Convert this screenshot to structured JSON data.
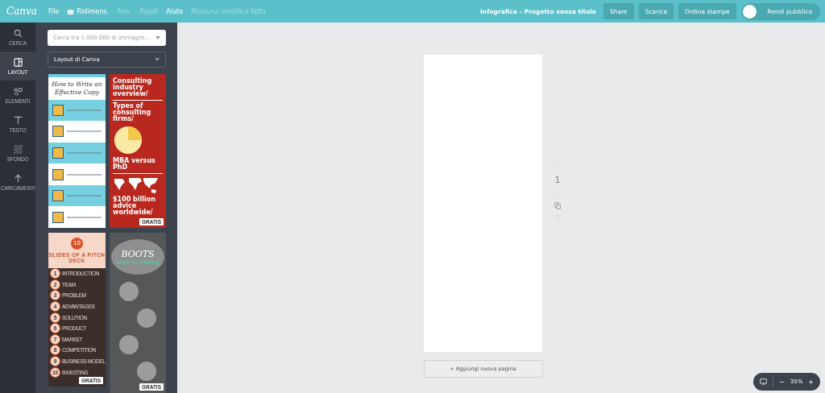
{
  "topbar": {
    "logo": "Canva",
    "menu": [
      {
        "label": "File",
        "kind": "plain",
        "disabled": false
      },
      {
        "label": "Ridimens.",
        "kind": "premium",
        "disabled": false
      },
      {
        "label": "Ann.",
        "kind": "plain",
        "disabled": true
      },
      {
        "label": "Ripeti",
        "kind": "plain",
        "disabled": true
      },
      {
        "label": "Aiuto",
        "kind": "plain",
        "disabled": false
      }
    ],
    "status": "Nessuna modifica fatta",
    "title": "Infografica – Progetto senza titolo",
    "buttons": [
      "Share",
      "Scarica",
      "Ordina stampe"
    ],
    "public_toggle": {
      "label": "Rendi pubblico",
      "on": false
    }
  },
  "sidebar": {
    "items": [
      {
        "label": "CERCA",
        "selected": false
      },
      {
        "label": "LAYOUT",
        "selected": true
      },
      {
        "label": "ELEMENTI",
        "selected": false
      },
      {
        "label": "TESTO",
        "selected": false
      },
      {
        "label": "SFONDO",
        "selected": false
      },
      {
        "label": "CARICAMENTI",
        "selected": false
      }
    ]
  },
  "panel": {
    "search": {
      "placeholder": "Cerca tra 1.000.000 di immagini..."
    },
    "dropdown": {
      "value": "Layout di Canva"
    },
    "templates": [
      {
        "kind": "copy",
        "title": "How to Write an Effective Copy"
      },
      {
        "kind": "consulting",
        "headings": [
          "Consulting industry overview/",
          "Types of consulting firms/",
          "MBA versus PhD",
          "$100 billion advice worldwide/"
        ],
        "badge": "GRATIS"
      },
      {
        "kind": "pitch",
        "number": "10",
        "title": "SLIDES OF A PITCH DECK",
        "items": [
          {
            "n": "1",
            "label": "INTRODUCTION"
          },
          {
            "n": "2",
            "label": "TEAM"
          },
          {
            "n": "3",
            "label": "PROBLEM"
          },
          {
            "n": "4",
            "label": "ADVANTAGES"
          },
          {
            "n": "5",
            "label": "SOLUTION"
          },
          {
            "n": "6",
            "label": "PRODUCT"
          },
          {
            "n": "7",
            "label": "MARKET"
          },
          {
            "n": "8",
            "label": "COMPETITION"
          },
          {
            "n": "9",
            "label": "BUSINESS MODEL"
          },
          {
            "n": "10",
            "label": "INVESTING"
          }
        ],
        "badge": "GRATIS"
      },
      {
        "kind": "boots",
        "title": "BOOTS",
        "subtitle": "Made For Walking",
        "badge": "GRATIS"
      }
    ]
  },
  "canvas": {
    "page_number": "1",
    "add_page": "+ Aggiungi nuova pagina"
  },
  "zoom": {
    "minus": "−",
    "value": "35%",
    "plus": "+"
  }
}
